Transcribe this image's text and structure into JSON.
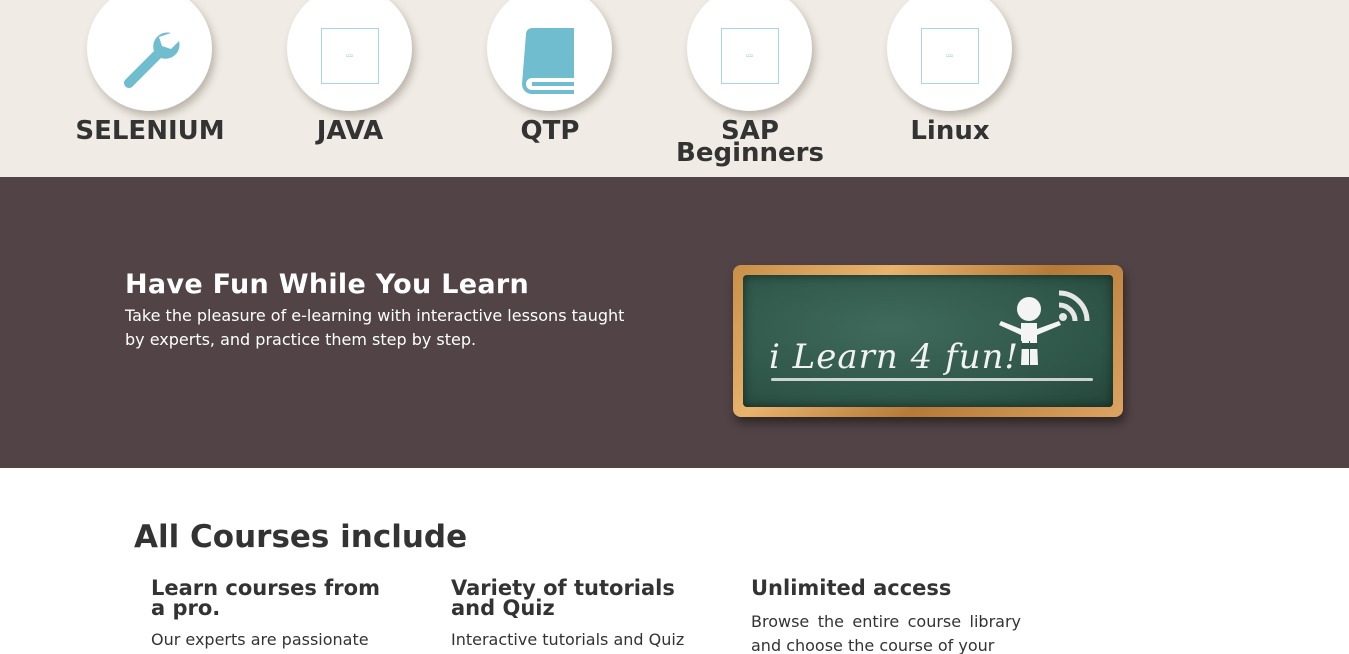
{
  "courses": [
    {
      "title": "SELENIUM",
      "icon": "wrench-icon"
    },
    {
      "title": "JAVA",
      "icon": "broken-image-icon"
    },
    {
      "title": "QTP",
      "icon": "book-icon"
    },
    {
      "title": "SAP Beginners",
      "icon": "broken-image-icon"
    },
    {
      "title": "Linux",
      "icon": "broken-image-icon"
    }
  ],
  "hero": {
    "title": "Have Fun While You Learn",
    "text": "Take the pleasure of e-learning with interactive lessons taught by experts, and practice them step by step.",
    "board_text": "i Learn 4 fun!"
  },
  "features": {
    "section_title": "All Courses include",
    "items": [
      {
        "title": "Learn courses from a pro.",
        "text": "Our experts are passionate"
      },
      {
        "title": "Variety of tutorials and Quiz",
        "text": "Interactive tutorials and Quiz for"
      },
      {
        "title": "Unlimited access",
        "text": "Browse the entire course library and choose the course of your"
      }
    ]
  },
  "colors": {
    "icon_blue": "#71bdd0",
    "strip_bg": "#f0ebe4",
    "hero_bg": "#524446"
  }
}
